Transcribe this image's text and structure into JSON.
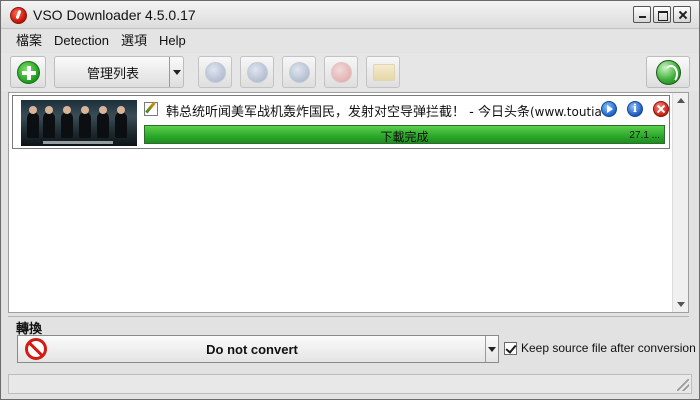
{
  "window": {
    "title": "VSO Downloader 4.5.0.17"
  },
  "menu": {
    "items": [
      "檔案",
      "Detection",
      "選項",
      "Help"
    ]
  },
  "toolbar": {
    "manage_list_label": "管理列表"
  },
  "download_list": {
    "items": [
      {
        "title": "韩总统听闻美军战机轰炸国民，发射对空导弹拦截！ - 今日头条",
        "site": "(www.toutiao.com)",
        "status": "下載完成",
        "size": "27.1 ...",
        "progress_percent": 100
      }
    ]
  },
  "conversion": {
    "section_label": "轉換",
    "selected_value": "Do not convert",
    "keep_source_label": "Keep source file after conversion",
    "keep_source_checked": true
  },
  "colors": {
    "progress_green": "#2ba82b",
    "accent_red": "#d21b12"
  }
}
